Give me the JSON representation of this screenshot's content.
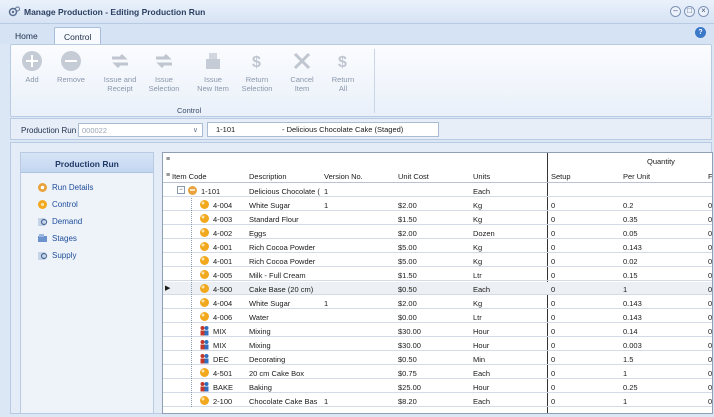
{
  "window": {
    "title": "Manage Production - Editing Production Run",
    "controls": [
      "–",
      "□",
      "×"
    ]
  },
  "tabs": [
    {
      "label": "Home"
    },
    {
      "label": "Control"
    }
  ],
  "help": "?",
  "ribbon": {
    "buttons": [
      {
        "label": "Add",
        "icon": "add-icon"
      },
      {
        "label": "Remove",
        "icon": "remove-icon"
      },
      {
        "label": "Issue and\nReceipt",
        "icon": "issue-receipt-icon"
      },
      {
        "label": "Issue\nSelection",
        "icon": "issue-selection-icon"
      },
      {
        "label": "Issue\nNew Item",
        "icon": "issue-new-item-icon"
      },
      {
        "label": "Return\nSelection",
        "icon": "return-selection-icon"
      },
      {
        "label": "Cancel\nItem",
        "icon": "cancel-item-icon"
      },
      {
        "label": "Return\nAll",
        "icon": "return-all-icon"
      }
    ],
    "group_label": "Control"
  },
  "production_run": {
    "label": "Production Run",
    "value": "000022",
    "code": "1-101",
    "description": "- Delicious Chocolate Cake (Staged)"
  },
  "sidebar": {
    "header": "Production Run",
    "items": [
      {
        "label": "Run Details",
        "icon": "run-details-icon"
      },
      {
        "label": "Control",
        "icon": "control-icon"
      },
      {
        "label": "Demand",
        "icon": "demand-icon"
      },
      {
        "label": "Stages",
        "icon": "stages-icon"
      },
      {
        "label": "Supply",
        "icon": "supply-icon"
      }
    ]
  },
  "grid": {
    "quantity_header": "Quantity",
    "columns": [
      "Item Code",
      "Description",
      "Version No.",
      "Unit Cost",
      "Units",
      "Setup",
      "Per Unit",
      "Fi"
    ],
    "rows": [
      {
        "code": "1-101",
        "description": "Delicious Chocolate (",
        "version": "1",
        "unit_cost": "",
        "units": "Each",
        "setup": "",
        "per_unit": "",
        "fi": "",
        "icon": "cake-icon",
        "root": true
      },
      {
        "code": "4-004",
        "description": "White Sugar",
        "version": "1",
        "unit_cost": "$2.00",
        "units": "Kg",
        "setup": "0",
        "per_unit": "0.2",
        "fi": "0",
        "icon": "item-icon"
      },
      {
        "code": "4-003",
        "description": "Standard Flour",
        "version": "",
        "unit_cost": "$1.50",
        "units": "Kg",
        "setup": "0",
        "per_unit": "0.35",
        "fi": "0",
        "icon": "item-icon"
      },
      {
        "code": "4-002",
        "description": "Eggs",
        "version": "",
        "unit_cost": "$2.00",
        "units": "Dozen",
        "setup": "0",
        "per_unit": "0.05",
        "fi": "0",
        "icon": "item-icon"
      },
      {
        "code": "4-001",
        "description": "Rich Cocoa Powder",
        "version": "",
        "unit_cost": "$5.00",
        "units": "Kg",
        "setup": "0",
        "per_unit": "0.143",
        "fi": "0",
        "icon": "item-icon"
      },
      {
        "code": "4-001",
        "description": "Rich Cocoa Powder",
        "version": "",
        "unit_cost": "$5.00",
        "units": "Kg",
        "setup": "0",
        "per_unit": "0.02",
        "fi": "0",
        "icon": "item-icon"
      },
      {
        "code": "4-005",
        "description": "Milk - Full Cream",
        "version": "",
        "unit_cost": "$1.50",
        "units": "Ltr",
        "setup": "0",
        "per_unit": "0.15",
        "fi": "0",
        "icon": "item-icon"
      },
      {
        "code": "4-500",
        "description": "Cake Base (20 cm)",
        "version": "",
        "unit_cost": "$0.50",
        "units": "Each",
        "setup": "0",
        "per_unit": "1",
        "fi": "0",
        "icon": "item-icon",
        "selected": true
      },
      {
        "code": "4-004",
        "description": "White Sugar",
        "version": "1",
        "unit_cost": "$2.00",
        "units": "Kg",
        "setup": "0",
        "per_unit": "0.143",
        "fi": "0",
        "icon": "item-icon"
      },
      {
        "code": "4-006",
        "description": "Water",
        "version": "",
        "unit_cost": "$0.00",
        "units": "Ltr",
        "setup": "0",
        "per_unit": "0.143",
        "fi": "0",
        "icon": "item-icon"
      },
      {
        "code": "MIX",
        "description": "Mixing",
        "version": "",
        "unit_cost": "$30.00",
        "units": "Hour",
        "setup": "0",
        "per_unit": "0.14",
        "fi": "0",
        "icon": "labour-icon"
      },
      {
        "code": "MIX",
        "description": "Mixing",
        "version": "",
        "unit_cost": "$30.00",
        "units": "Hour",
        "setup": "0",
        "per_unit": "0.003",
        "fi": "0",
        "icon": "labour-icon"
      },
      {
        "code": "DEC",
        "description": "Decorating",
        "version": "",
        "unit_cost": "$0.50",
        "units": "Min",
        "setup": "0",
        "per_unit": "1.5",
        "fi": "0",
        "icon": "labour-icon"
      },
      {
        "code": "4-501",
        "description": "20 cm Cake Box",
        "version": "",
        "unit_cost": "$0.75",
        "units": "Each",
        "setup": "0",
        "per_unit": "1",
        "fi": "0",
        "icon": "item-icon"
      },
      {
        "code": "BAKE",
        "description": "Baking",
        "version": "",
        "unit_cost": "$25.00",
        "units": "Hour",
        "setup": "0",
        "per_unit": "0.25",
        "fi": "0",
        "icon": "labour-icon"
      },
      {
        "code": "2-100",
        "description": "Chocolate Cake Bas",
        "version": "1",
        "unit_cost": "$8.20",
        "units": "Each",
        "setup": "0",
        "per_unit": "1",
        "fi": "0",
        "icon": "item-icon"
      }
    ]
  },
  "colors": {
    "accent": "#1e4d9a",
    "title_bar": "#d6e3f4",
    "item_icon": "#f2a81d",
    "labour_icon": "#c0392b"
  }
}
